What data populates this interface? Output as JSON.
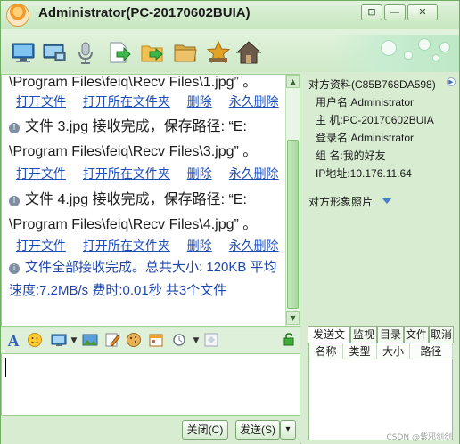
{
  "window": {
    "title": "Administrator(PC-20170602BUIA)",
    "controls": [
      "⊡",
      "—",
      "✕"
    ]
  },
  "toolbar": {
    "icons": [
      "monitor-icon",
      "remote-desktop-icon",
      "microphone-icon",
      "send-file-icon",
      "send-folder-icon",
      "folder-icon",
      "open-folder-icon",
      "star-icon",
      "home-icon"
    ]
  },
  "chat": {
    "lines": {
      "l0_path": "\\Program Files\\feiq\\Recv Files\\1.jpg” 。",
      "l0_links": [
        "打开文件",
        "打开所在文件夹",
        "删除",
        "永久删除"
      ],
      "m1_text": "文件 3.jpg 接收完成，保存路径: “E:",
      "m1_path": "\\Program Files\\feiq\\Recv Files\\3.jpg” 。",
      "m1_links": [
        "打开文件",
        "打开所在文件夹",
        "删除",
        "永久删除"
      ],
      "m2_text": "文件 4.jpg 接收完成，保存路径: “E:",
      "m2_path": "\\Program Files\\feiq\\Recv Files\\4.jpg” 。",
      "m2_links": [
        "打开文件",
        "打开所在文件夹",
        "删除",
        "永久删除"
      ],
      "summary": "文件全部接收完成。总共大小: 120KB 平均速度:7.2MB/s 费时:0.01秒  共3个文件"
    }
  },
  "input_toolbar": {
    "font_icon": "A",
    "icons": [
      "font-icon",
      "emoji-icon",
      "screenshot-icon",
      "image-icon",
      "handwriting-icon",
      "cookie-icon",
      "calendar-icon",
      "shake-icon",
      "history-icon",
      "lock-icon"
    ]
  },
  "buttons": {
    "close_label": "关闭(C)",
    "send_label": "发送(S)",
    "send_dropdown": "▾"
  },
  "right_panel": {
    "header": "对方资料(C85B768DA598)",
    "username": "用户名:Administrator",
    "host": "主  机:PC-20170602BUIA",
    "login": "登录名:Administrator",
    "group": "组  名:我的好友",
    "ip": "IP地址:10.176.11.64",
    "photo_label": "对方形象照片",
    "tabs": [
      "发送文件",
      "监视",
      "目录",
      "文件",
      "取消"
    ],
    "table_headers": [
      "名称",
      "类型",
      "大小",
      "路径"
    ]
  },
  "watermark": "CSDN @紫邪剑剑"
}
